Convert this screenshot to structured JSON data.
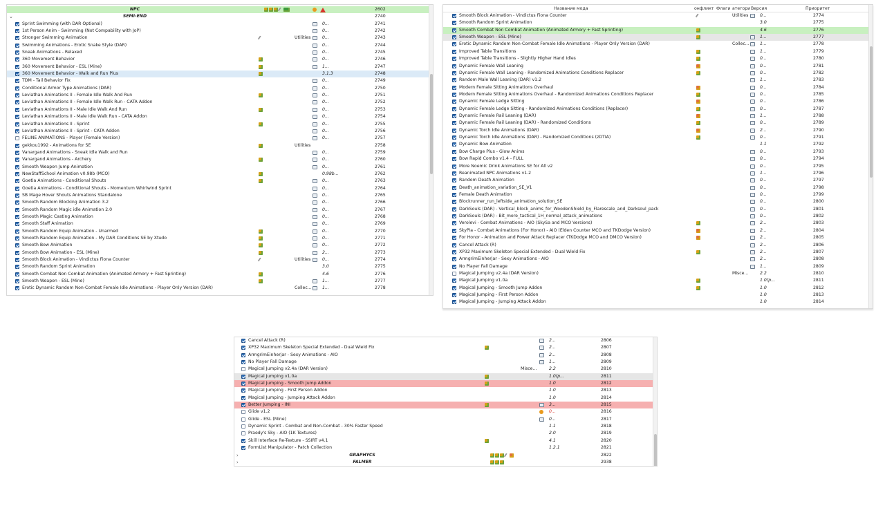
{
  "colors": {
    "checkbox_on": "#2f6fb6",
    "highlight_green": "#c8f0c0",
    "highlight_blue": "#dbeaf7",
    "highlight_red": "#f6b0b0",
    "highlight_gray": "#e6e6e6"
  },
  "panel1": {
    "rows": [
      {
        "sep": true,
        "name": "NPC",
        "icons": [
          "puzzle",
          "puzzle",
          "puzzle",
          "wrench",
          "green-logo"
        ],
        "flag_icons": [
          "gear-icon",
          "warning-icon"
        ],
        "priority": "2602",
        "hl": "green"
      },
      {
        "sep": true,
        "expander": "⌄",
        "name": "SEMI-END",
        "priority": "2740"
      },
      {
        "cb": true,
        "name": "Sprint Swimming (with DAR Optional)",
        "box": true,
        "ver": "0...",
        "priority": "2741"
      },
      {
        "cb": true,
        "name": "1st Person Anim - Swimming (Not Compability with JoP)",
        "box": true,
        "ver": "0...",
        "priority": "2742"
      },
      {
        "cb": true,
        "name": "Stronger Swimming Animation",
        "icon": "wrench",
        "cat": "Utilities",
        "box": true,
        "ver": "0...",
        "priority": "2743"
      },
      {
        "cb": true,
        "name": "Swimming Animations - Erotic Snake Style (DAR)",
        "box": true,
        "ver": "0...",
        "priority": "2744"
      },
      {
        "cb": true,
        "name": "Sneak Animations - Relaxed",
        "box": true,
        "ver": "0...",
        "priority": "2745"
      },
      {
        "cb": true,
        "name": "360 Movement Behavior",
        "icon": "puzzle",
        "box": true,
        "ver": "0...",
        "priority": "2746"
      },
      {
        "cb": true,
        "name": "360 Movement Behavior - ESL (Mine)",
        "icon": "puzzle",
        "box": true,
        "ver": "1...",
        "priority": "2747"
      },
      {
        "cb": true,
        "name": "360 Movement Behavior - Walk and Run Plus",
        "icon": "puzzle",
        "ver": "3.1.3",
        "priority": "2748",
        "hl": "blue"
      },
      {
        "cb": true,
        "name": "TDM - Tail Behavior Fix",
        "box": true,
        "ver": "0...",
        "priority": "2749"
      },
      {
        "cb": true,
        "name": "Conditional Armor Type Animations (DAR)",
        "box": true,
        "ver": "0...",
        "priority": "2750"
      },
      {
        "cb": true,
        "name": "Leviathan Animations II - Female Idle Walk And Run",
        "icon": "puzzle",
        "box": true,
        "ver": "0...",
        "priority": "2751"
      },
      {
        "cb": true,
        "name": "Leviathan Animations II - Female Idle Walk Run - CATA Addon",
        "box": true,
        "ver": "0...",
        "priority": "2752"
      },
      {
        "cb": true,
        "name": "Leviathan Animations II - Male Idle Walk And Run",
        "icon": "puzzle",
        "box": true,
        "ver": "0...",
        "priority": "2753"
      },
      {
        "cb": true,
        "name": "Leviathan Animations II - Male Idle Walk Run - CATA Addon",
        "box": true,
        "ver": "0...",
        "priority": "2754"
      },
      {
        "cb": true,
        "name": "Leviathan Animations II - Sprint",
        "icon": "puzzle",
        "box": true,
        "ver": "0...",
        "priority": "2755"
      },
      {
        "cb": true,
        "name": "Leviathan Animations II - Sprint - CATA Addon",
        "box": true,
        "ver": "0...",
        "priority": "2756"
      },
      {
        "cb": false,
        "name": "FELINE ANIMATIONS - Player (Female Version)",
        "box": true,
        "ver": "0...",
        "priority": "2757"
      },
      {
        "cb": true,
        "name": "gekkou1992 - Animations for SE",
        "icon": "puzzle",
        "cat": "Utilities",
        "priority": "2758"
      },
      {
        "cb": true,
        "name": "Vanargand Animations - Sneak Idle Walk and Run",
        "box": true,
        "ver": "0...",
        "priority": "2759"
      },
      {
        "cb": true,
        "name": "Vanargand Animations - Archery",
        "icon": "puzzle",
        "box": true,
        "ver": "0...",
        "priority": "2760"
      },
      {
        "cb": true,
        "name": "Smooth Weapon Jump Animation",
        "box": true,
        "ver": "0...",
        "priority": "2761"
      },
      {
        "cb": true,
        "name": "NewStaffSchool Animation v0.98b (MCO)",
        "icon": "puzzle",
        "ver": "0.98b...",
        "priority": "2762"
      },
      {
        "cb": true,
        "name": "Goetia Animations - Conditional Shouts",
        "icon": "puzzle",
        "box": true,
        "ver": "0...",
        "priority": "2763"
      },
      {
        "cb": true,
        "name": "Goetia Animations - Conditional Shouts - Momentum Whirlwind Sprint",
        "box": true,
        "ver": "0...",
        "priority": "2764"
      },
      {
        "cb": true,
        "name": "SB Mage Hover Shouts Animations Standalone",
        "box": true,
        "ver": "0...",
        "priority": "2765"
      },
      {
        "cb": true,
        "name": "Smooth Random Blocking Animation 3.2",
        "box": true,
        "ver": "0...",
        "priority": "2766"
      },
      {
        "cb": true,
        "name": "Smooth Random Magic idle Animation 2.0",
        "box": true,
        "ver": "0...",
        "priority": "2767"
      },
      {
        "cb": true,
        "name": "Smooth Magic Casting Animation",
        "box": true,
        "ver": "0...",
        "priority": "2768"
      },
      {
        "cb": true,
        "name": "Smooth Staff Animation",
        "box": true,
        "ver": "0...",
        "priority": "2769"
      },
      {
        "cb": true,
        "name": "Smooth Random Equip Animation - Unarmed",
        "icon": "puzzle",
        "box": true,
        "ver": "0...",
        "priority": "2770"
      },
      {
        "cb": true,
        "name": "Smooth Random Equip Animation - My DAR Conditions SE by Xtudo",
        "icon": "puzzle",
        "box": true,
        "ver": "0...",
        "priority": "2771"
      },
      {
        "cb": true,
        "name": "Smooth Bow Animation",
        "icon": "puzzle",
        "box": true,
        "ver": "0...",
        "priority": "2772"
      },
      {
        "cb": true,
        "name": "Smooth Bow Animation - ESL (Mine)",
        "icon": "puzzle",
        "box": true,
        "ver": "2...",
        "priority": "2773"
      },
      {
        "cb": true,
        "name": "Smooth Block Animation - Vindictus Fiona Counter",
        "icon": "wrench",
        "cat": "Utilities",
        "box": true,
        "ver": "0...",
        "priority": "2774"
      },
      {
        "cb": true,
        "name": "Smooth Random Sprint Animation",
        "ver": "3.0",
        "priority": "2775"
      },
      {
        "cb": true,
        "name": "Smooth Combat Non Combat Animation (Animated Armory + Fast Sprinting)",
        "icon": "puzzle",
        "ver": "4.6",
        "priority": "2776"
      },
      {
        "cb": true,
        "name": "Smooth Weapon - ESL (Mine)",
        "icon": "puzzle",
        "box": true,
        "ver": "1...",
        "priority": "2777"
      },
      {
        "cb": true,
        "name": "Erotic Dynamic Random Non-Combat Female Idle Animations - Player Only Version (DAR)",
        "cat": "Collec...",
        "box": true,
        "ver": "1...",
        "priority": "2778"
      }
    ]
  },
  "panel2": {
    "headers": {
      "name": "Название мода",
      "conflict": "онфликт",
      "flags": "Флаги",
      "category": "атегори",
      "version": "Версия",
      "priority": "Приоритет"
    },
    "rows": [
      {
        "cb": true,
        "name": "Smooth Block Animation - Vindictus Fiona Counter",
        "icon": "wrench",
        "cat": "Utilities",
        "box": true,
        "ver": "0...",
        "priority": "2774"
      },
      {
        "cb": true,
        "name": "Smooth Random Sprint Animation",
        "ver": "3.0",
        "priority": "2775"
      },
      {
        "cb": true,
        "name": "Smooth Combat Non Combat Animation (Animated Armory + Fast Sprinting)",
        "icon": "puzzle",
        "ver": "4.6",
        "priority": "2776",
        "hl": "green"
      },
      {
        "cb": true,
        "name": "Smooth Weapon - ESL (Mine)",
        "icon": "puzzle",
        "box": true,
        "ver": "1...",
        "priority": "2777",
        "hl": "gray"
      },
      {
        "cb": true,
        "name": "Erotic Dynamic Random Non-Combat Female Idle Animations - Player Only Version (DAR)",
        "cat": "Collec...",
        "box": true,
        "ver": "1...",
        "priority": "2778"
      },
      {
        "cb": true,
        "name": "Improved Table Transitions",
        "icon": "puzzle",
        "box": true,
        "ver": "1...",
        "priority": "2779"
      },
      {
        "cb": true,
        "name": "Improved Table Transitions - Slightly Higher Hand Idles",
        "icon": "puzzle",
        "box": true,
        "ver": "0...",
        "priority": "2780"
      },
      {
        "cb": true,
        "name": "Dynamic Female Wall Leaning",
        "icon": "red",
        "box": true,
        "ver": "0...",
        "priority": "2781"
      },
      {
        "cb": true,
        "name": "Dynamic Female Wall Leaning - Randomized Animations Conditions Replacer",
        "icon": "puzzle",
        "box": true,
        "ver": "0...",
        "priority": "2782"
      },
      {
        "cb": true,
        "name": "Random Male Wall Leaning (DAR) v1.2",
        "box": true,
        "ver": "1...",
        "priority": "2783"
      },
      {
        "cb": true,
        "name": "Modern Female Sitting Animations Overhaul",
        "icon": "red",
        "box": true,
        "ver": "0...",
        "priority": "2784"
      },
      {
        "cb": true,
        "name": "Modern Female Sitting Animations Overhaul - Randomized Animations Conditions Replacer",
        "icon": "puzzle",
        "box": true,
        "ver": "0...",
        "priority": "2785"
      },
      {
        "cb": true,
        "name": "Dynamic Female Ledge Sitting",
        "icon": "red",
        "box": true,
        "ver": "0...",
        "priority": "2786"
      },
      {
        "cb": true,
        "name": "Dynamic Female Ledge Sitting - Randomized Animations Conditions (Replacer)",
        "icon": "puzzle",
        "box": true,
        "ver": "0...",
        "priority": "2787"
      },
      {
        "cb": true,
        "name": "Dynamic Female Rail Leaning (DAR)",
        "icon": "red",
        "box": true,
        "ver": "1...",
        "priority": "2788"
      },
      {
        "cb": true,
        "name": "Dynamic Female Rail Leaning (DAR) - Randomized Conditions",
        "icon": "puzzle",
        "box": true,
        "ver": "0...",
        "priority": "2789"
      },
      {
        "cb": true,
        "name": "Dynamic Torch Idle Animations (DAR)",
        "icon": "red",
        "box": true,
        "ver": "2...",
        "priority": "2790"
      },
      {
        "cb": true,
        "name": "Dynamic Torch Idle Animations (DAR) - Randomized Conditions (zDTIA)",
        "icon": "puzzle",
        "box": true,
        "ver": "0...",
        "priority": "2791"
      },
      {
        "cb": true,
        "name": "Dynamic Bow Animation",
        "ver": "1.1",
        "priority": "2792"
      },
      {
        "cb": true,
        "name": "Bow Charge Plus - Glow Anims",
        "box": true,
        "ver": "0...",
        "priority": "2793"
      },
      {
        "cb": true,
        "name": "Bow Rapid Combo v1.4 - FULL",
        "box": true,
        "ver": "0...",
        "priority": "2794"
      },
      {
        "cb": true,
        "name": "More Noemic Drink Animations SE for All v2",
        "box": true,
        "ver": "0...",
        "priority": "2795"
      },
      {
        "cb": true,
        "name": "Reanimated NPC Animations v1.2",
        "box": true,
        "ver": "1...",
        "priority": "2796"
      },
      {
        "cb": true,
        "name": "Random Death Animation",
        "box": true,
        "ver": "0...",
        "priority": "2797"
      },
      {
        "cb": true,
        "name": "Death_animation_variation_SE_V1",
        "box": true,
        "ver": "0...",
        "priority": "2798"
      },
      {
        "cb": true,
        "name": "Female Death Animation",
        "box": true,
        "ver": "0...",
        "priority": "2799"
      },
      {
        "cb": true,
        "name": "Blockrunner_run_leftside_animation_solution_SE",
        "box": true,
        "ver": "0...",
        "priority": "2800"
      },
      {
        "cb": true,
        "name": "DarkSouls (DAR) - Vertical_block_anims_for_WoodenShield_by_Flarescale_and_Darksoul_pack",
        "box": true,
        "ver": "0...",
        "priority": "2801"
      },
      {
        "cb": true,
        "name": "DarkSouls (DAR) - Bit_more_tactical_1H_normal_attack_animations",
        "box": true,
        "ver": "0...",
        "priority": "2802"
      },
      {
        "cb": true,
        "name": "Verolevi - Combat Animations - AIO (SkySa and MCO Versions)",
        "icon": "puzzle",
        "box": true,
        "ver": "2...",
        "priority": "2803"
      },
      {
        "cb": true,
        "name": "SkyPia - Combat Animations (For Honor) - AIO (Elden Counter MCO and TKDodge Version)",
        "icon": "red",
        "box": true,
        "ver": "2...",
        "priority": "2804"
      },
      {
        "cb": true,
        "name": "For Honor - Animation and Power Attack Replacer (TKDodge MCO and DMCO Version)",
        "icon": "red",
        "box": true,
        "ver": "2...",
        "priority": "2805"
      },
      {
        "cb": true,
        "name": "Cancel Attack (R)",
        "box": true,
        "ver": "2...",
        "priority": "2806"
      },
      {
        "cb": true,
        "name": "XP32 Maximum Skeleton Special Extended - Dual Wield Fix",
        "icon": "puzzle",
        "box": true,
        "ver": "2...",
        "priority": "2807"
      },
      {
        "cb": true,
        "name": "ArmgrimEinherjar - Sexy Animations - AIO",
        "box": true,
        "ver": "2...",
        "priority": "2808"
      },
      {
        "cb": true,
        "name": "No Player Fall Damage",
        "box": true,
        "ver": "1...",
        "priority": "2809"
      },
      {
        "cb": false,
        "name": "Magical Jumping v2.4a (DAR Version)",
        "cat": "Misce...",
        "ver": "2.2",
        "priority": "2810"
      },
      {
        "cb": true,
        "name": "Magical Jumping v1.0a",
        "icon": "puzzle",
        "ver": "1.0(p...",
        "priority": "2811"
      },
      {
        "cb": true,
        "name": "Magical Jumping - Smooth Jump Addon",
        "icon": "puzzle",
        "ver": "1.0",
        "priority": "2812"
      },
      {
        "cb": true,
        "name": "Magical Jumping - First Person Addon",
        "ver": "1.0",
        "priority": "2813"
      },
      {
        "cb": true,
        "name": "Magical Jumping - Jumping Attack Addon",
        "ver": "1.0",
        "priority": "2814"
      }
    ]
  },
  "panel3": {
    "rows": [
      {
        "cb": true,
        "name": "Cancel Attack (R)",
        "box": true,
        "ver": "2...",
        "priority": "2806"
      },
      {
        "cb": true,
        "name": "XP32 Maximum Skeleton Special Extended - Dual Wield Fix",
        "icon": "puzzle",
        "box": true,
        "ver": "2...",
        "priority": "2807"
      },
      {
        "cb": true,
        "name": "ArmgrimEinherjar - Sexy Animations - AIO",
        "box": true,
        "ver": "2...",
        "priority": "2808"
      },
      {
        "cb": true,
        "name": "No Player Fall Damage",
        "box": true,
        "ver": "1...",
        "priority": "2809"
      },
      {
        "cb": false,
        "name": "Magical Jumping v2.4a (DAR Version)",
        "cat": "Misce...",
        "ver": "2.2",
        "priority": "2810"
      },
      {
        "cb": true,
        "name": "Magical Jumping v1.0a",
        "icon": "puzzle",
        "ver": "1.0(p...",
        "priority": "2811",
        "hl": "gray"
      },
      {
        "cb": true,
        "name": "Magical Jumping - Smooth Jump Addon",
        "icon": "puzzle",
        "ver": "1.0",
        "priority": "2812",
        "hl": "red"
      },
      {
        "cb": true,
        "name": "Magical Jumping - First Person Addon",
        "ver": "1.0",
        "priority": "2813"
      },
      {
        "cb": true,
        "name": "Magical Jumping - Jumping Attack Addon",
        "ver": "1.0",
        "priority": "2814"
      },
      {
        "cb": true,
        "name": "Better Jumping - INI",
        "icon": "puzzle",
        "box": true,
        "ver": "3...",
        "priority": "2815",
        "hl": "red"
      },
      {
        "cb": false,
        "name": "Glide v1.2",
        "gear": true,
        "ver": "0...",
        "priority": "2816"
      },
      {
        "cb": false,
        "name": "Glide - ESL (Mine)",
        "box": true,
        "ver": "0...",
        "priority": "2817"
      },
      {
        "cb": false,
        "name": "Dynamic Sprint - Combat and Non-Combat - 30% Faster Speed",
        "ver": "1.1",
        "priority": "2818"
      },
      {
        "cb": false,
        "name": "Praedy's Sky - AIO (1K Textures)",
        "ver": "2.0",
        "priority": "2819"
      },
      {
        "cb": true,
        "name": "Skill Interface Re-Texture - SSIRT v4.1",
        "icon": "puzzle",
        "ver": "4.1",
        "priority": "2820"
      },
      {
        "cb": true,
        "name": "FormList Manipulator - Patch Collection",
        "ver": "1.2.1",
        "priority": "2821"
      },
      {
        "sep": true,
        "expander": "›",
        "name": "GRAPHYCS",
        "icons": [
          "puzzle",
          "puzzle",
          "puzzle",
          "wrench",
          "red"
        ],
        "priority": "2822"
      },
      {
        "sep": true,
        "expander": "›",
        "name": "FALMER",
        "icons": [
          "puzzle",
          "puzzle",
          "puzzle"
        ],
        "priority": "2938"
      }
    ]
  }
}
